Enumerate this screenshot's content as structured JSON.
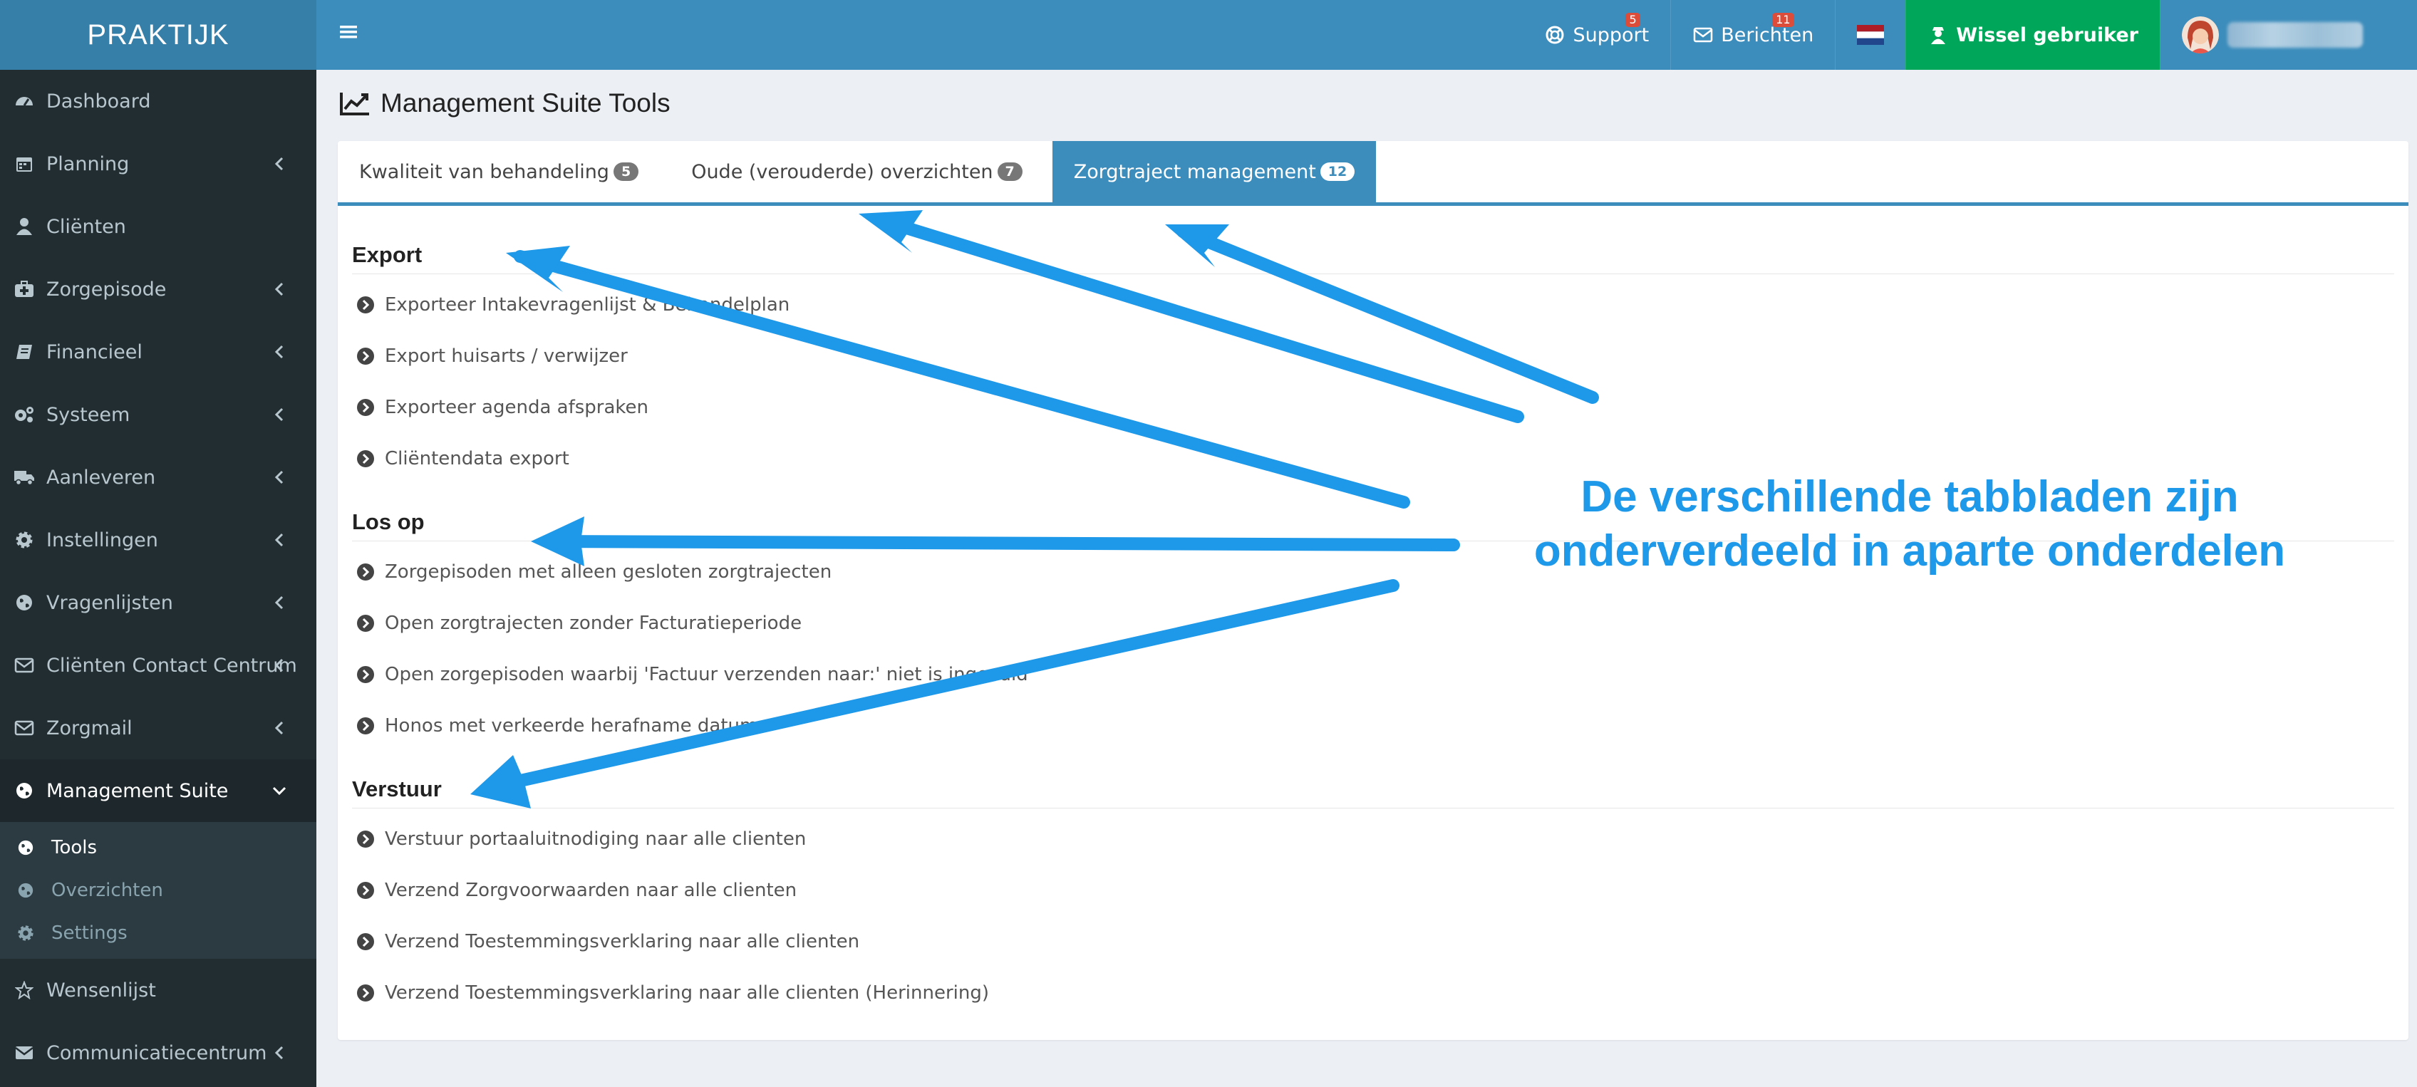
{
  "app": {
    "logo": "PRAKTIJK"
  },
  "sidebar": {
    "items": [
      {
        "label": "Dashboard",
        "icon": "dashboard-icon",
        "chevron": false
      },
      {
        "label": "Planning",
        "icon": "calendar-icon",
        "chevron": true
      },
      {
        "label": "Cliënten",
        "icon": "user-icon",
        "chevron": false
      },
      {
        "label": "Zorgepisode",
        "icon": "medkit-icon",
        "chevron": true
      },
      {
        "label": "Financieel",
        "icon": "book-icon",
        "chevron": true
      },
      {
        "label": "Systeem",
        "icon": "cogs-icon",
        "chevron": true
      },
      {
        "label": "Aanleveren",
        "icon": "truck-icon",
        "chevron": true
      },
      {
        "label": "Instellingen",
        "icon": "gear-icon",
        "chevron": true
      },
      {
        "label": "Vragenlijsten",
        "icon": "globe-icon",
        "chevron": true
      },
      {
        "label": "Cliënten Contact Centrum",
        "icon": "envelope-icon",
        "chevron": true
      },
      {
        "label": "Zorgmail",
        "icon": "envelope-icon",
        "chevron": true
      },
      {
        "label": "Management Suite",
        "icon": "globe-icon",
        "chevron": "down"
      }
    ],
    "submenu": [
      {
        "label": "Tools",
        "icon": "globe-icon",
        "active": true
      },
      {
        "label": "Overzichten",
        "icon": "globe-icon",
        "active": false
      },
      {
        "label": "Settings",
        "icon": "gear-icon",
        "active": false
      }
    ],
    "items_after": [
      {
        "label": "Wensenlijst",
        "icon": "star-icon",
        "chevron": false
      },
      {
        "label": "Communicatiecentrum",
        "icon": "envelope-icon",
        "chevron": true
      }
    ]
  },
  "header": {
    "support_label": "Support",
    "support_badge": "5",
    "messages_label": "Berichten",
    "messages_badge": "11",
    "switch_user_label": "Wissel gebruiker"
  },
  "page": {
    "title": "Management Suite Tools"
  },
  "tabs": [
    {
      "label": "Kwaliteit van behandeling",
      "count": "5",
      "active": false
    },
    {
      "label": "Oude (verouderde) overzichten",
      "count": "7",
      "active": false
    },
    {
      "label": "Zorgtraject management",
      "count": "12",
      "active": true
    }
  ],
  "sections": [
    {
      "title": "Export",
      "items": [
        "Exporteer Intakevragenlijst & Behandelplan",
        "Export huisarts / verwijzer",
        "Exporteer agenda afspraken",
        "Cliëntendata export"
      ]
    },
    {
      "title": "Los op",
      "items": [
        "Zorgepisoden met alleen gesloten zorgtrajecten",
        "Open zorgtrajecten zonder Facturatieperiode",
        "Open zorgepisoden waarbij 'Factuur verzenden naar:' niet is ingevuld",
        "Honos met verkeerde herafname datum"
      ]
    },
    {
      "title": "Verstuur",
      "items": [
        "Verstuur portaaluitnodiging naar alle clienten",
        "Verzend Zorgvoorwaarden naar alle clienten",
        "Verzend Toestemmingsverklaring naar alle clienten",
        "Verzend Toestemmingsverklaring naar alle clienten (Herinnering)"
      ]
    }
  ],
  "annotation": {
    "line1": "De verschillende tabbladen zijn",
    "line2": "onderverdeeld in aparte onderdelen",
    "color": "#1e98e8"
  },
  "colors": {
    "sidebar": "#222d32",
    "header": "#3c8dbc",
    "logo_bg": "#367fa9",
    "switch_user": "#00a65a",
    "badge": "#dd4b39"
  }
}
